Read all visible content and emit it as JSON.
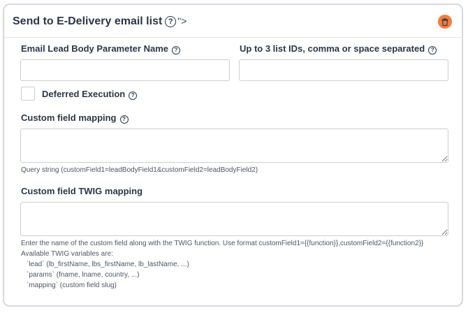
{
  "card": {
    "title": "Send to E-Delivery email list",
    "title_help_glyph": "?",
    "title_suffix": "\">",
    "delete_icon": "trash-icon",
    "accent_color": "#f07e3f"
  },
  "fields": {
    "email_param": {
      "label": "Email Lead Body Parameter Name",
      "value": ""
    },
    "list_ids": {
      "label": "Up to 3 list IDs, comma or space separated",
      "value": ""
    },
    "deferred": {
      "label": "Deferred Execution",
      "checked": false
    },
    "custom_mapping": {
      "label": "Custom field mapping",
      "value": "",
      "help": "Query string (customField1=leadBodyField1&customField2=leadBodyField2)"
    },
    "twig_mapping": {
      "label": "Custom field TWIG mapping",
      "value": "",
      "help_lines": [
        "Enter the name of the custom field along with the TWIG function. Use format customField1={{function}},customField2={{function2}}",
        "Available TWIG variables are:",
        "`lead` (lb_firstName, lbs_firstName, lb_lastName, ...)",
        "`params` (fname, lname, country, ...)",
        "`mapping` (custom field slug)"
      ]
    }
  },
  "help_glyph": "?"
}
